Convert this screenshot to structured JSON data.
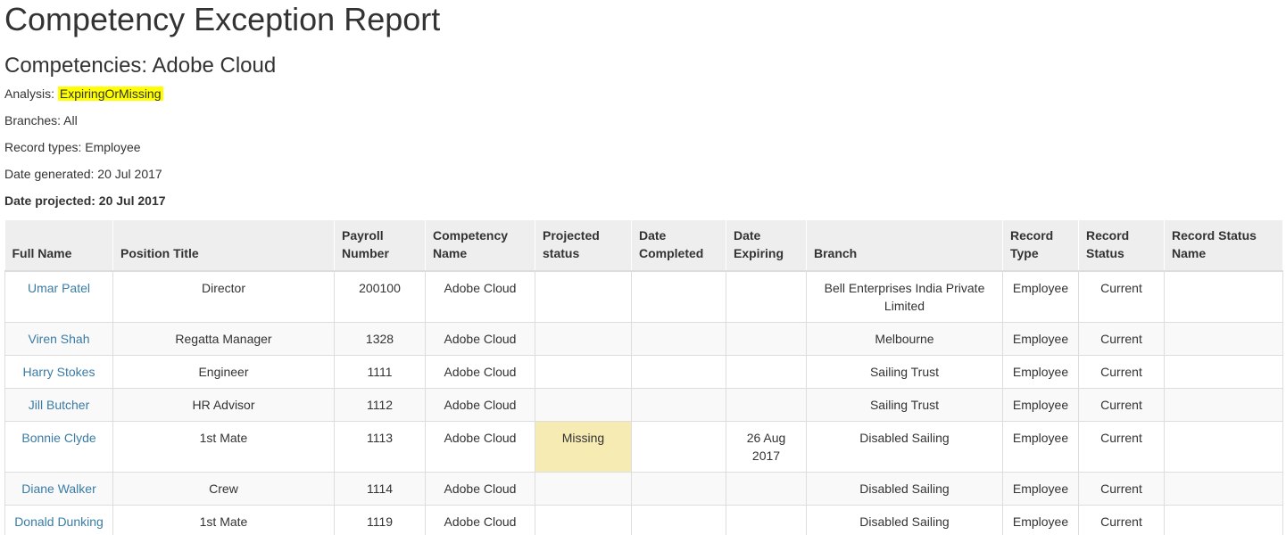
{
  "report": {
    "title": "Competency Exception Report",
    "subtitle": "Competencies: Adobe Cloud",
    "analysis_label": "Analysis: ",
    "analysis_value": "ExpiringOrMissing",
    "branches": "Branches: All",
    "record_types": "Record types: Employee",
    "date_generated": "Date generated: 20 Jul 2017",
    "date_projected": "Date projected: 20 Jul 2017"
  },
  "colors": {
    "highlight": "#ffff00",
    "missing_cell": "#f7ebb4",
    "link": "#3a7ca5",
    "header_bg": "#eeeeee"
  },
  "table": {
    "headers": [
      "Full Name",
      "Position Title",
      "Payroll Number",
      "Competency Name",
      "Projected status",
      "Date Completed",
      "Date Expiring",
      "Branch",
      "Record Type",
      "Record Status",
      "Record Status Name"
    ],
    "rows": [
      [
        "Umar Patel",
        "Director",
        "200100",
        "Adobe Cloud",
        "",
        "",
        "",
        "Bell Enterprises India Private Limited",
        "Employee",
        "Current",
        ""
      ],
      [
        "Viren Shah",
        "Regatta Manager",
        "1328",
        "Adobe Cloud",
        "",
        "",
        "",
        "Melbourne",
        "Employee",
        "Current",
        ""
      ],
      [
        "Harry Stokes",
        "Engineer",
        "1111",
        "Adobe Cloud",
        "",
        "",
        "",
        "Sailing Trust",
        "Employee",
        "Current",
        ""
      ],
      [
        "Jill Butcher",
        "HR Advisor",
        "1112",
        "Adobe Cloud",
        "",
        "",
        "",
        "Sailing Trust",
        "Employee",
        "Current",
        ""
      ],
      [
        "Bonnie Clyde",
        "1st Mate",
        "1113",
        "Adobe Cloud",
        "Missing",
        "",
        "26 Aug 2017",
        "Disabled Sailing",
        "Employee",
        "Current",
        ""
      ],
      [
        "Diane Walker",
        "Crew",
        "1114",
        "Adobe Cloud",
        "",
        "",
        "",
        "Disabled Sailing",
        "Employee",
        "Current",
        ""
      ],
      [
        "Donald Dunking",
        "1st Mate",
        "1119",
        "Adobe Cloud",
        "",
        "",
        "",
        "Disabled Sailing",
        "Employee",
        "Current",
        ""
      ]
    ]
  }
}
